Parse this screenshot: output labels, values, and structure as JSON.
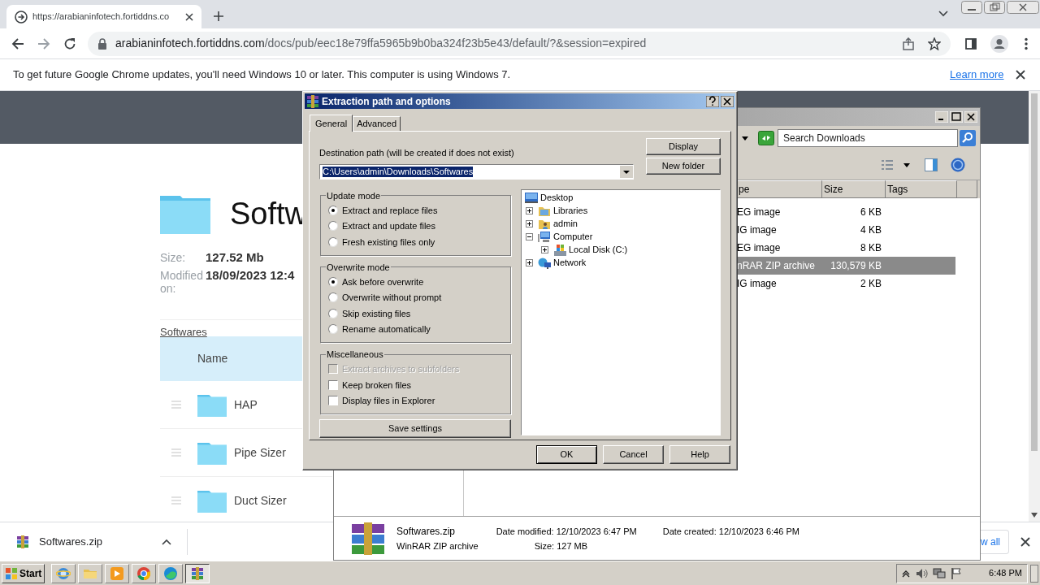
{
  "browser": {
    "tab_title": "https://arabianinfotech.fortiddns.co",
    "address_host": "arabianinfotech.fortiddns.com",
    "address_path": "/docs/pub/eec18e79ffa5965b9b0ba324f23b5e43/default/?&session=expired"
  },
  "infobar": {
    "message": "To get future Google Chrome updates, you'll need Windows 10 or later. This computer is using Windows 7.",
    "link": "Learn more"
  },
  "page": {
    "title": "Softw",
    "meta": [
      {
        "label": "Size:",
        "value": "127.52 Mb"
      },
      {
        "label": "Modified on:",
        "value": "18/09/2023 12:4"
      }
    ],
    "breadcrumb": "Softwares",
    "table": {
      "column": "Name",
      "rows": [
        {
          "name": "HAP"
        },
        {
          "name": "Pipe Sizer"
        },
        {
          "name": "Duct Sizer"
        }
      ]
    }
  },
  "download_bar": {
    "file": "Softwares.zip",
    "show_all": "w all"
  },
  "explorer": {
    "search": {
      "placeholder": "Search Downloads"
    },
    "columns": [
      "pe",
      "Size",
      "Tags"
    ],
    "rows": [
      {
        "type": "EG image",
        "size": "6 KB",
        "selected": false
      },
      {
        "type": "IG image",
        "size": "4 KB",
        "selected": false
      },
      {
        "type": "EG image",
        "size": "8 KB",
        "selected": false
      },
      {
        "type": "nRAR ZIP archive",
        "size": "130,579 KB",
        "selected": true
      },
      {
        "type": "IG image",
        "size": "2 KB",
        "selected": false
      }
    ],
    "details": {
      "name": "Softwares.zip",
      "type": "WinRAR ZIP archive",
      "modified_label": "Date modified:",
      "modified": "12/10/2023 6:47 PM",
      "size_label": "Size:",
      "size": "127 MB",
      "created_label": "Date created:",
      "created": "12/10/2023 6:46 PM"
    }
  },
  "dialog": {
    "title": "Extraction path and options",
    "tabs": [
      {
        "label": "General",
        "selected": true
      },
      {
        "label": "Advanced",
        "selected": false
      }
    ],
    "destination": {
      "label": "Destination path (will be created if does not exist)",
      "value": "C:\\Users\\admin\\Downloads\\Softwares"
    },
    "side_buttons": [
      "Display",
      "New folder"
    ],
    "groups": [
      {
        "title": "Update mode",
        "kind": "radio",
        "options": [
          {
            "label": "Extract and replace files",
            "selected": true
          },
          {
            "label": "Extract and update files",
            "selected": false
          },
          {
            "label": "Fresh existing files only",
            "selected": false
          }
        ]
      },
      {
        "title": "Overwrite mode",
        "kind": "radio",
        "options": [
          {
            "label": "Ask before overwrite",
            "selected": true
          },
          {
            "label": "Overwrite without prompt",
            "selected": false
          },
          {
            "label": "Skip existing files",
            "selected": false
          },
          {
            "label": "Rename automatically",
            "selected": false
          }
        ]
      },
      {
        "title": "Miscellaneous",
        "kind": "checkbox",
        "options": [
          {
            "label": "Extract archives to subfolders",
            "checked": false,
            "disabled": true
          },
          {
            "label": "Keep broken files",
            "checked": false,
            "disabled": false
          },
          {
            "label": "Display files in Explorer",
            "checked": false,
            "disabled": false
          }
        ]
      }
    ],
    "save_button": "Save settings",
    "tree": [
      {
        "label": "Desktop",
        "kind": "desktop",
        "children": [
          {
            "label": "Libraries",
            "kind": "library",
            "expanded": false
          },
          {
            "label": "admin",
            "kind": "user",
            "expanded": false
          },
          {
            "label": "Computer",
            "kind": "computer",
            "expanded": true,
            "children": [
              {
                "label": "Local Disk (C:)",
                "kind": "disk",
                "expanded": false
              }
            ]
          },
          {
            "label": "Network",
            "kind": "network",
            "expanded": false
          }
        ]
      }
    ],
    "buttons": [
      {
        "label": "OK",
        "default": true
      },
      {
        "label": "Cancel",
        "default": false
      },
      {
        "label": "Help",
        "default": false
      }
    ]
  },
  "taskbar": {
    "start": "Start",
    "apps": [
      {
        "kind": "ie",
        "active": false
      },
      {
        "kind": "folder",
        "active": false
      },
      {
        "kind": "media",
        "active": false
      },
      {
        "kind": "chrome",
        "active": false
      },
      {
        "kind": "edge",
        "active": false
      },
      {
        "kind": "winrar",
        "active": true
      }
    ],
    "clock": "6:48 PM"
  }
}
